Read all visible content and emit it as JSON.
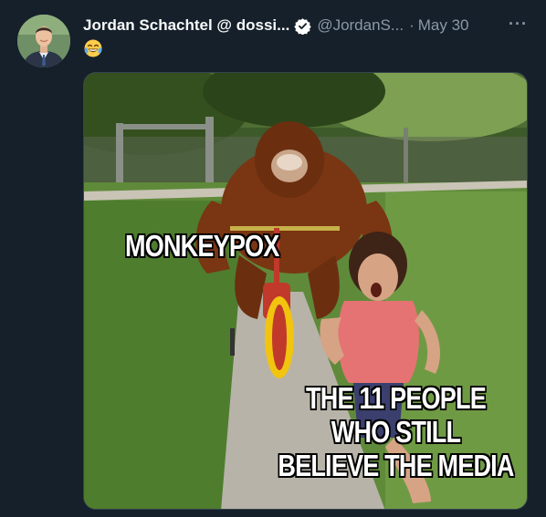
{
  "tweet": {
    "display_name": "Jordan Schachtel @ dossi...",
    "handle": "@JordanS...",
    "separator": "·",
    "date": "May 30",
    "more_label": "···",
    "text_emoji": "😂"
  },
  "meme": {
    "top_caption": "MONKEYPOX",
    "bottom_caption_lines": [
      "THE 11 PEOPLE",
      "WHO STILL",
      "BELIEVE THE MEDIA"
    ]
  },
  "colors": {
    "background": "#15202b",
    "text_primary": "#f7f9f9",
    "text_secondary": "#8b98a5",
    "verified_badge": "#ffffff"
  }
}
